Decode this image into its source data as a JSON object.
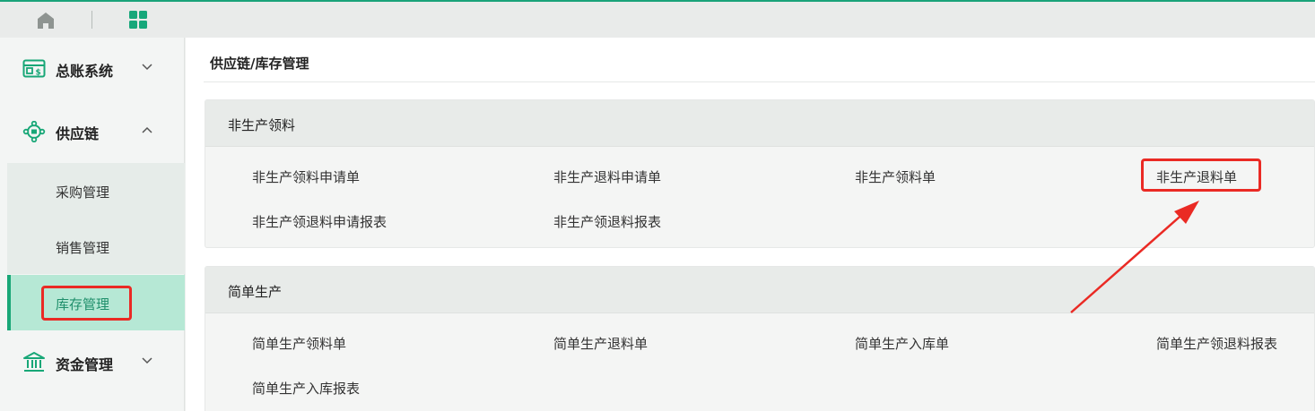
{
  "topbar": {
    "home_icon": "home-icon",
    "apps_icon": "apps-grid-icon"
  },
  "sidebar": {
    "groups": [
      {
        "label": "总账系统",
        "icon": "ledger-icon",
        "expanded": false
      },
      {
        "label": "供应链",
        "icon": "supply-chain-icon",
        "expanded": true
      },
      {
        "label": "资金管理",
        "icon": "bank-icon",
        "expanded": false
      }
    ],
    "sub_items": [
      {
        "label": "采购管理"
      },
      {
        "label": "销售管理"
      },
      {
        "label": "库存管理",
        "active": true
      }
    ]
  },
  "main": {
    "breadcrumb": "供应链/库存管理",
    "sections": [
      {
        "title": "非生产领料",
        "links": [
          "非生产领料申请单",
          "非生产退料申请单",
          "非生产领料单",
          "非生产退料单",
          "非生产领退料申请报表",
          "非生产领退料报表"
        ]
      },
      {
        "title": "简单生产",
        "links": [
          "简单生产领料单",
          "简单生产退料单",
          "简单生产入库单",
          "简单生产领退料报表",
          "简单生产入库报表"
        ]
      }
    ]
  },
  "colors": {
    "accent": "#1aa37a",
    "highlight_red": "#ea2a24",
    "active_bg": "#b6e8d5"
  }
}
